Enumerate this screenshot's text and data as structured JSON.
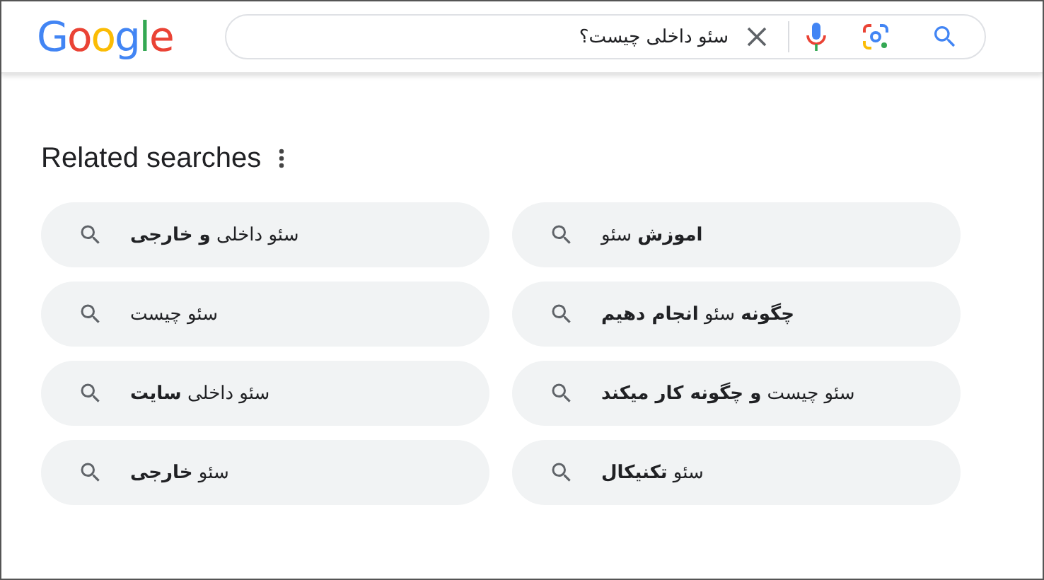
{
  "logo": "Google",
  "search": {
    "value": "سئو داخلی چیست؟"
  },
  "related": {
    "title": "Related searches",
    "rows": [
      {
        "items": [
          {
            "text": "**اموزش** سئو"
          },
          {
            "text": "سئو داخلی **و خارجی**"
          }
        ]
      },
      {
        "items": [
          {
            "text": "**چگونه** سئو **انجام دهیم**"
          },
          {
            "text": "سئو چیست"
          }
        ]
      },
      {
        "items": [
          {
            "text": "سئو چیست **و چگونه کار میکند**"
          },
          {
            "text": "سئو داخلی **سایت**"
          }
        ]
      },
      {
        "items": [
          {
            "text": "سئو **تکنیکال**"
          },
          {
            "text": "سئو **خارجی**"
          }
        ]
      }
    ]
  }
}
